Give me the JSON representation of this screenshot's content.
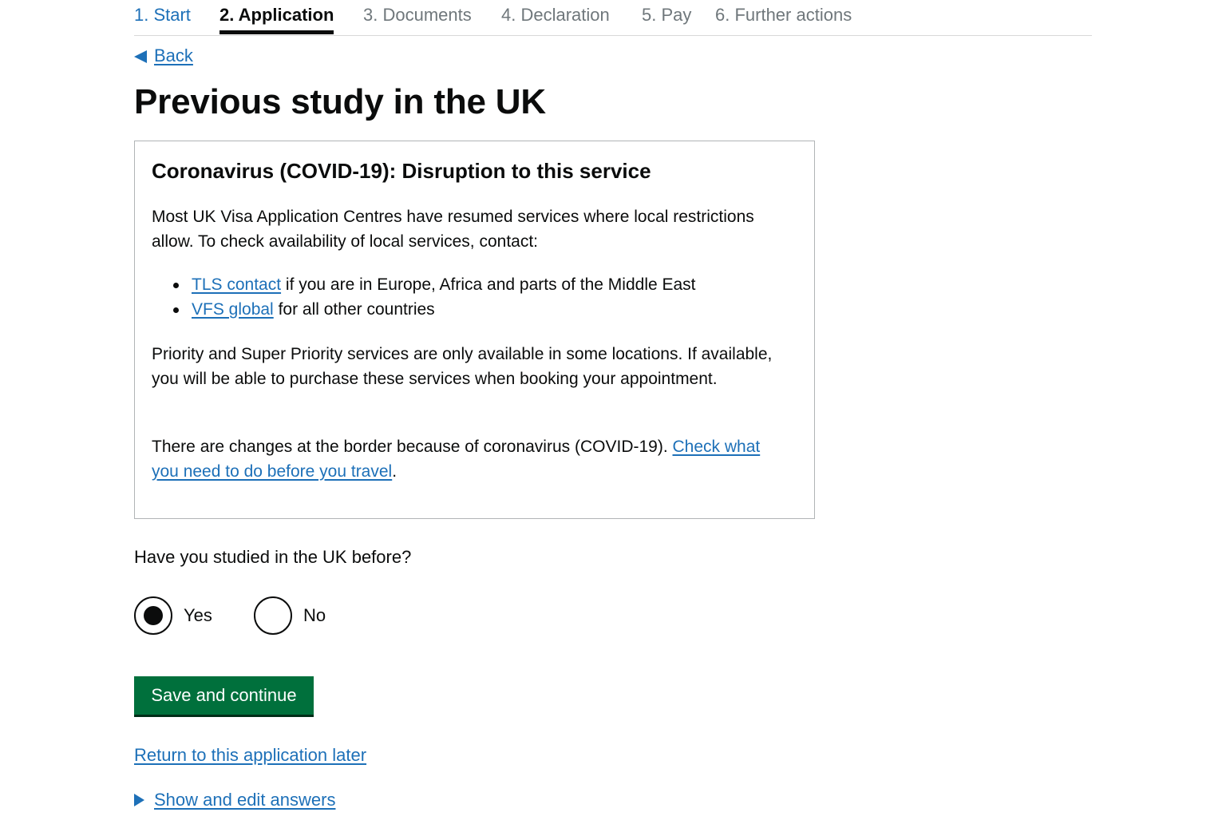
{
  "steps": [
    {
      "label": "1. Start",
      "state": "link"
    },
    {
      "label": "2. Application",
      "state": "current"
    },
    {
      "label": "3. Documents",
      "state": "disabled"
    },
    {
      "label": "4. Declaration",
      "state": "disabled"
    },
    {
      "label": "5. Pay",
      "state": "disabled"
    },
    {
      "label": "6. Further actions",
      "state": "disabled"
    }
  ],
  "back": {
    "label": "Back"
  },
  "page_title": "Previous study in the UK",
  "notice": {
    "title": "Coronavirus (COVID-19): Disruption to this service",
    "para1": "Most UK Visa Application Centres have resumed services where local restrictions allow. To check availability of local services, contact:",
    "bullets": [
      {
        "link": "TLS contact",
        "text": " if you are in Europe, Africa and parts of the Middle East"
      },
      {
        "link": "VFS global",
        "text": " for all other countries"
      }
    ],
    "para2": "Priority and Super Priority services are only available in some locations. If available, you will be able to purchase these services when booking your appointment.",
    "para3_text": "There are changes at the border because of coronavirus (COVID-19). ",
    "para3_link": "Check what you need to do before you travel",
    "para3_end": "."
  },
  "question": {
    "label": "Have you studied in the UK before?",
    "options": [
      {
        "label": "Yes",
        "selected": true
      },
      {
        "label": "No",
        "selected": false
      }
    ]
  },
  "save_button": "Save and continue",
  "return_link": "Return to this application later",
  "details_summary": "Show and edit answers",
  "colors": {
    "link": "#1d70b8",
    "button_green": "#00703c",
    "text": "#0b0c0c",
    "muted": "#6f777b",
    "border": "#b1b4b6"
  }
}
